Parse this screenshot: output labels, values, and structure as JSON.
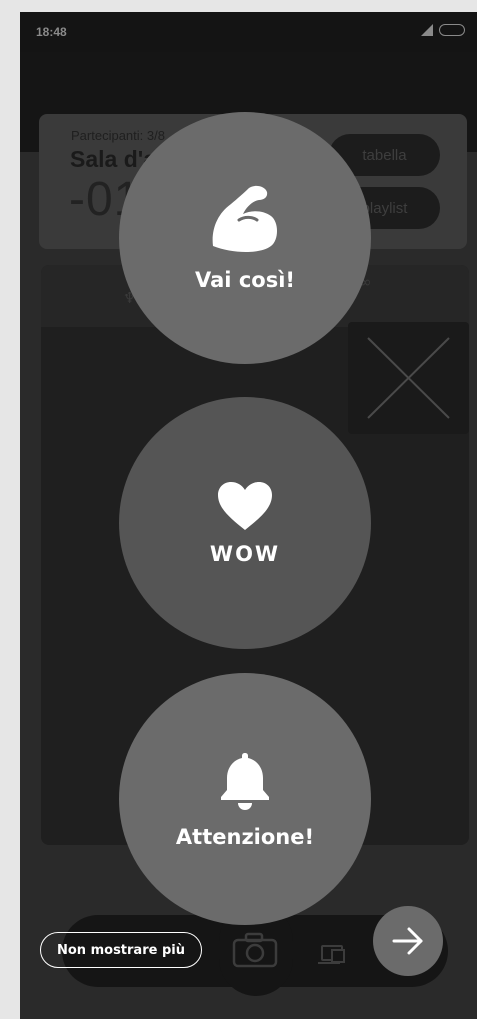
{
  "status_bar": {
    "time": "18:48"
  },
  "room": {
    "participants": "Partecipanti: 3/8",
    "title": "Sala d'attesa",
    "countdown": "-01:25"
  },
  "header_buttons": {
    "table": "tabella",
    "playlist": "playlist"
  },
  "reactions": [
    {
      "label": "Vai così!",
      "icon": "flexed-biceps-icon"
    },
    {
      "label": "WOW",
      "icon": "heart-icon"
    },
    {
      "label": "Attenzione!",
      "icon": "bell-icon"
    }
  ],
  "overlay": {
    "dont_show_again": "Non mostrare più",
    "next_icon": "arrow-right-icon"
  },
  "pager": {
    "pages": 3
  },
  "colors": {
    "overlay_bubble": "#6b6b6b",
    "background": "#2a2a2a",
    "text_on_overlay": "#ffffff"
  }
}
